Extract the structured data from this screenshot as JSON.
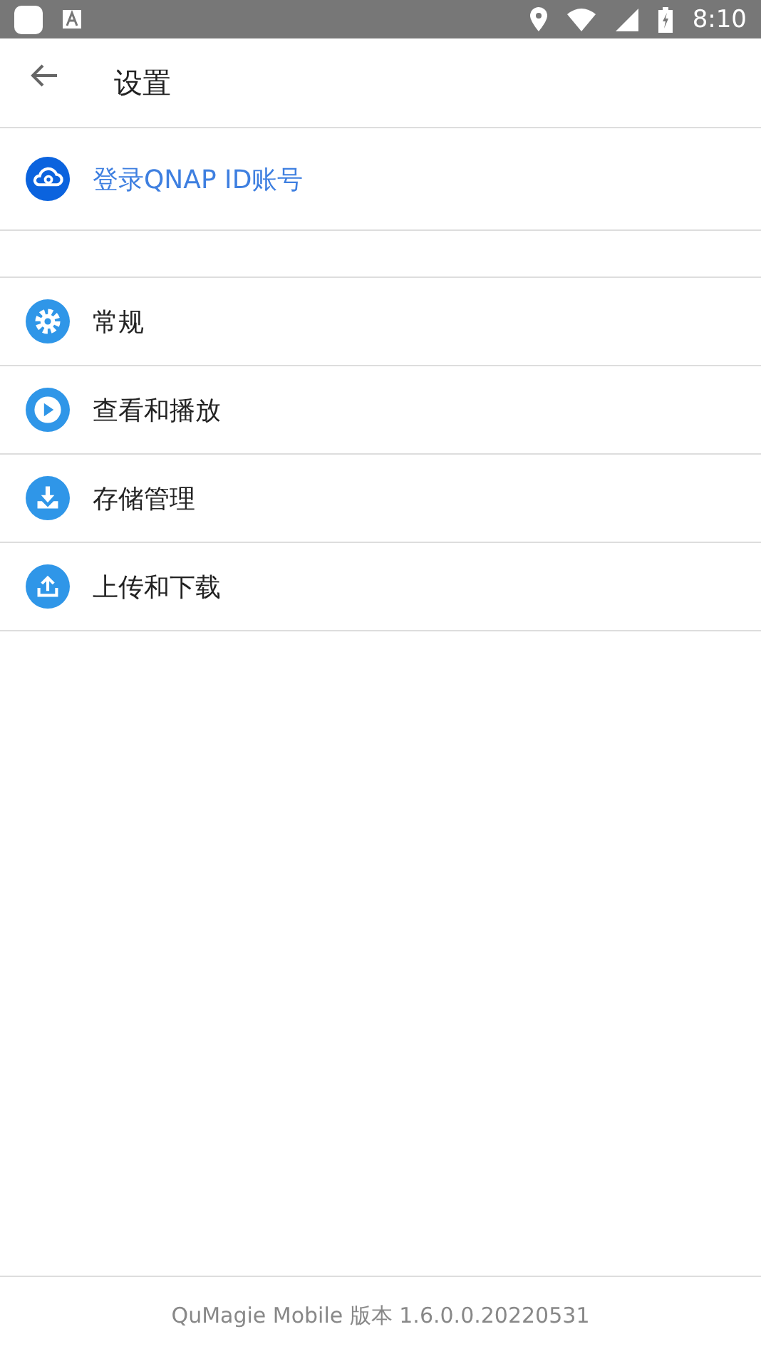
{
  "status_bar": {
    "time": "8:10"
  },
  "header": {
    "title": "设置"
  },
  "account": {
    "label": "登录QNAP ID账号"
  },
  "menu": [
    {
      "kind": "gear",
      "label": "常规"
    },
    {
      "kind": "play",
      "label": "查看和播放"
    },
    {
      "kind": "download",
      "label": "存储管理"
    },
    {
      "kind": "upload",
      "label": "上传和下载"
    }
  ],
  "footer": {
    "version": "QuMagie Mobile 版本 1.6.0.0.20220531"
  }
}
